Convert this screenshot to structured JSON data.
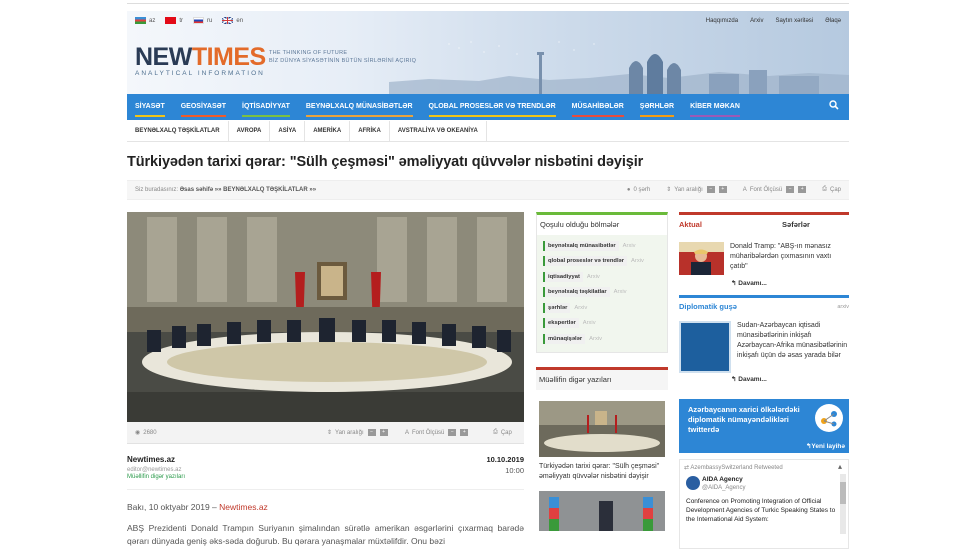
{
  "header": {
    "languages": [
      {
        "code": "az",
        "flag": [
          "#3a8fd6",
          "#e04040",
          "#3a9a3a"
        ]
      },
      {
        "code": "tr",
        "flag": [
          "#e30a17",
          "#e30a17",
          "#e30a17"
        ]
      },
      {
        "code": "ru",
        "flag": [
          "#ffffff",
          "#2046b6",
          "#e23232"
        ]
      },
      {
        "code": "en",
        "flag": [
          "#1f3f8a",
          "#d23a3a",
          "#1f3f8a"
        ]
      }
    ],
    "toplinks": [
      "Haqqımızda",
      "Arxiv",
      "Saytın xəritəsi",
      "Əlaqə"
    ],
    "logo_new": "NEW",
    "logo_times": "TIMES",
    "logo_sub": "ANALYTICAL INFORMATION",
    "tagline1": "THE THINKING OF FUTURE",
    "tagline2": "BİZ DÜNYA SİYASƏTİNİN BÜTÜN SİRLƏRİNİ AÇIRIQ"
  },
  "nav": {
    "items": [
      {
        "label": "SİYASƏT",
        "color": "#f0c419"
      },
      {
        "label": "GEOSİYASƏT",
        "color": "#ef5b2a"
      },
      {
        "label": "İQTİSADİYYAT",
        "color": "#7bc043"
      },
      {
        "label": "BEYNƏLXALQ MÜNASİBƏTLƏR",
        "color": "#e8a33d"
      },
      {
        "label": "QLOBAL PROSESLƏR VƏ TRENDLƏR",
        "color": "#f0c419"
      },
      {
        "label": "MÜSAHİBƏLƏR",
        "color": "#e74c3c"
      },
      {
        "label": "ŞƏRHLƏR",
        "color": "#f39c12"
      },
      {
        "label": "KİBER MƏKAN",
        "color": "#9b59b6"
      }
    ],
    "search_icon": "search-icon"
  },
  "subnav": [
    "BEYNƏLXALQ TƏŞKİLATLAR",
    "AVROPA",
    "ASİYA",
    "AMERİKA",
    "AFRİKA",
    "AVSTRALİYA VƏ OKEANİYA"
  ],
  "article": {
    "title": "Türkiyədən tarixi qərar: \"Sülh çeşməsi\" əməliyyatı qüvvələr nisbətini dəyişir",
    "crumb_prefix": "Siz buradasınız:",
    "crumb_home": "Əsas səhifə",
    "crumb_sep": "»»",
    "crumb_cat": "BEYNƏLXALQ TƏŞKİLATLAR",
    "crumb_end": "»»",
    "comments": "0 şərh",
    "line_spacing": "Yan aralığı",
    "font_size": "Font Ölçüsü",
    "print": "Çap",
    "views": "2680",
    "author_name": "Newtimes.az",
    "author_mail": "editor@newtimes.az",
    "author_link": "Müəllifin digər yazıları",
    "date": "10.10.2019",
    "time": "10:00",
    "dateline_text": "Bakı, 10 oktyabr 2019 –",
    "dateline_source": "Newtimes.az",
    "lead": "ABŞ Prezidenti Donald Trampın Suriyanın şimalından sürətlə amerikan əsgərlərini çıxarmaq barədə qərarı dünyada geniş əks-səda doğurub. Bu qərara yanaşmalar müxtəlifdir. Onu bəzi"
  },
  "middle": {
    "cats_title": "Qoşulu olduğu bölmələr",
    "archive": "Arxiv",
    "cats": [
      "beynəlxalq münasibətlər",
      "qlobal proseslər və trendlər",
      "iqtisadiyyat",
      "beynəlxalq təşkilatlar",
      "şərhlər",
      "ekspertlər",
      "münaqişələr"
    ],
    "other_title": "Müəllifin digər yazıları",
    "other_caption": "Türkiyədən tarixi qərar: \"Sülh çeşməsi\" əməliyyatı qüvvələr nisbətini dəyişir"
  },
  "right": {
    "tab_active": "Aktual",
    "tab_inactive": "Səfərlər",
    "news1": "Donald Tramp: \"ABŞ-ın mənasız müharibələrdən çıxmasının vaxtı çatıb\"",
    "more": "Davamı...",
    "dip_title": "Diplomatik guşə",
    "dip_archive": "arxiv",
    "news2": "Sudan-Azərbaycan iqtisadi münasibətlərinin inkişafı Azərbaycan-Afrika münasibətlərinin inkişafı üçün də əsas yarada bilər",
    "banner_text": "Azərbaycanın xarici ölkələrdəki diplomatik nümayəndəlikləri twitterdə",
    "banner_link": "Yeni layihə",
    "tw_retweet": "AzembassySwitzerland Retweeted",
    "tw_name": "AIDA Agency",
    "tw_handle": "@AIDA_Agency",
    "tw_body": "Conference on Promoting Integration of Official Development Agencies of Turkic Speaking States to the International Aid System:"
  }
}
